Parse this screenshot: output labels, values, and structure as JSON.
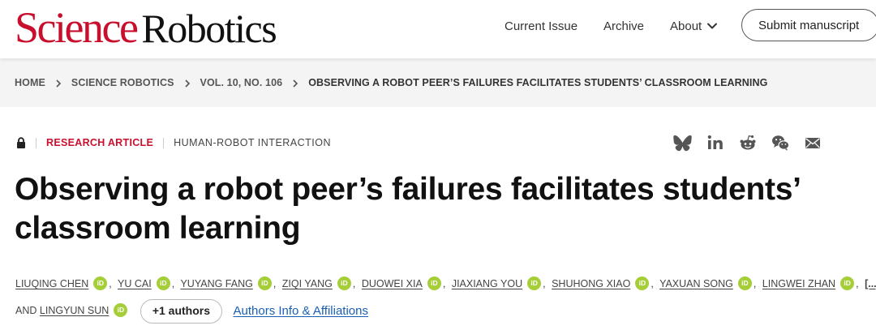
{
  "header": {
    "logo_part1": "Science",
    "logo_part2": "Robotics",
    "nav": {
      "current_issue": "Current Issue",
      "archive": "Archive",
      "about": "About"
    },
    "submit_label": "Submit manuscript"
  },
  "breadcrumb": {
    "items": [
      "HOME",
      "SCIENCE ROBOTICS",
      "VOL. 10, NO. 106",
      "OBSERVING A ROBOT PEER’S FAILURES FACILITATES STUDENTS’ CLASSROOM LEARNING"
    ]
  },
  "article": {
    "type": "RESEARCH ARTICLE",
    "subject": "HUMAN-ROBOT INTERACTION",
    "title_line1": "Observing a robot peer’s failures facilitates students’",
    "title_line2": "classroom learning",
    "authors_line1": [
      "LIUQING CHEN",
      "YU CAI",
      "YUYANG FANG",
      "ZIQI YANG",
      "DUOWEI XIA",
      "JIAXIANG YOU",
      "SHUHONG XIAO",
      "YAXUAN SONG",
      "LINGWEI ZHAN"
    ],
    "ellipsis": "[...]",
    "and_label": "AND",
    "last_author": "LINGYUN SUN",
    "orcid_label": "iD",
    "more_authors_label": "+1 authors",
    "affiliations_link": "Authors Info & Affiliations"
  },
  "share_icons": [
    "bluesky-icon",
    "linkedin-icon",
    "reddit-icon",
    "wechat-icon",
    "email-icon"
  ],
  "colors": {
    "brand_red": "#c8102e",
    "orcid_green": "#a6ce39",
    "link_blue": "#1a5fb4",
    "crumb_bg": "#f4f4f4"
  }
}
